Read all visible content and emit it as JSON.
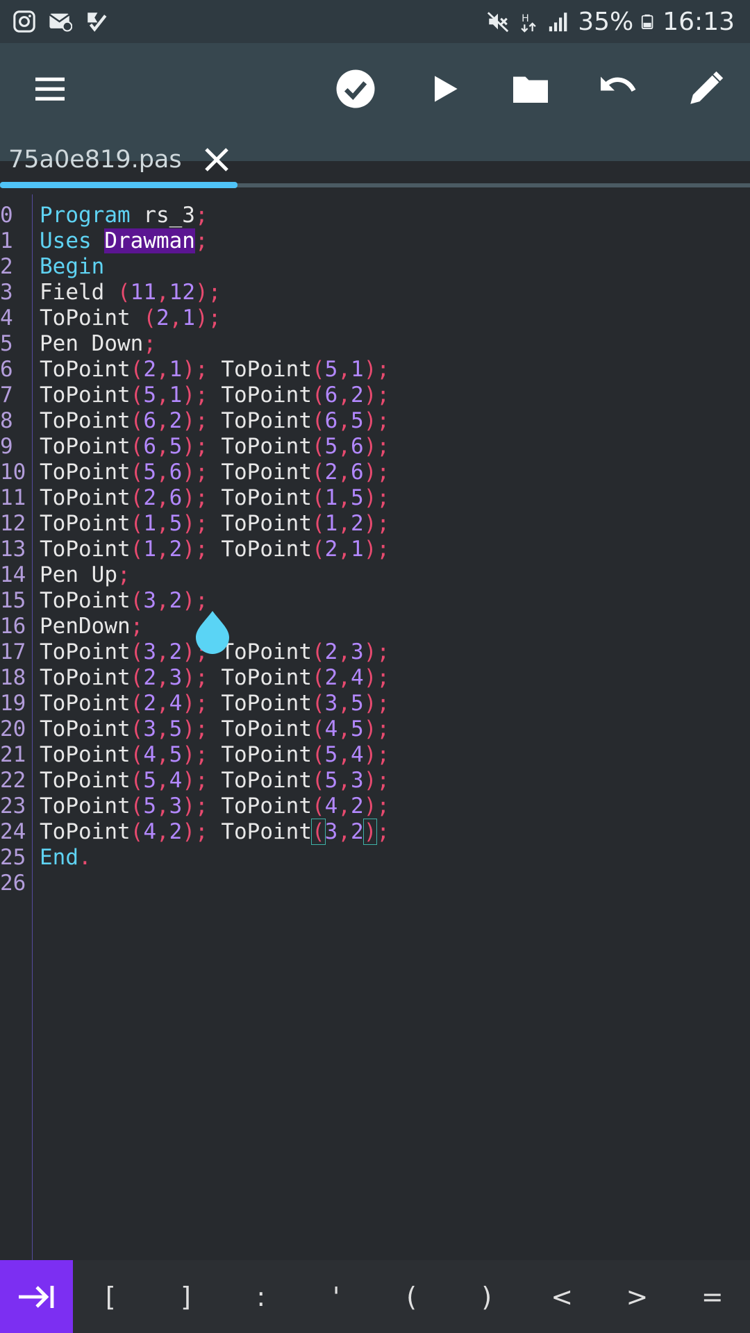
{
  "status_bar": {
    "left_icons": [
      "instagram-icon",
      "mail-icon",
      "check-badge-icon"
    ],
    "right_icons": [
      "mute-icon",
      "network-icon",
      "signal-icon",
      "battery-icon"
    ],
    "battery": "35%",
    "time": "16:13"
  },
  "toolbar": {
    "icons": [
      "menu-icon",
      "check-circle-icon",
      "play-icon",
      "folder-icon",
      "undo-icon",
      "edit-icon"
    ]
  },
  "tab": {
    "file_name": "75a0e819.pas"
  },
  "editor": {
    "line_numbers": [
      "0",
      "1",
      "2",
      "3",
      "4",
      "5",
      "6",
      "7",
      "8",
      "9",
      "10",
      "11",
      "12",
      "13",
      "14",
      "15",
      "16",
      "17",
      "18",
      "19",
      "20",
      "21",
      "22",
      "23",
      "24",
      "25",
      "26"
    ],
    "lines": [
      "Program rs_3;",
      "Uses Drawman;",
      "Begin",
      "Field (11,12);",
      "ToPoint (2,1);",
      "Pen Down;",
      "ToPoint(2,1); ToPoint(5,1);",
      "ToPoint(5,1); ToPoint(6,2);",
      "ToPoint(6,2); ToPoint(6,5);",
      "ToPoint(6,5); ToPoint(5,6);",
      "ToPoint(5,6); ToPoint(2,6);",
      "ToPoint(2,6); ToPoint(1,5);",
      "ToPoint(1,5); ToPoint(1,2);",
      "ToPoint(1,2); ToPoint(2,1);",
      "Pen Up;",
      "ToPoint(3,2);",
      "PenDown;",
      "ToPoint(3,2); ToPoint(2,3);",
      "ToPoint(2,3); ToPoint(2,4);",
      "ToPoint(2,4); ToPoint(3,5);",
      "ToPoint(3,5); ToPoint(4,5);",
      "ToPoint(4,5); ToPoint(5,4);",
      "ToPoint(5,4); ToPoint(5,3);",
      "ToPoint(5,3); ToPoint(4,2);",
      "ToPoint(4,2); ToPoint(3,2);",
      "End.",
      ""
    ],
    "highlighted_word": "Drawman"
  },
  "keybar": {
    "tab_key_icon": "tab-key-icon",
    "keys": [
      "[",
      "]",
      ":",
      "'",
      "(",
      ")",
      "<",
      ">",
      "="
    ]
  }
}
